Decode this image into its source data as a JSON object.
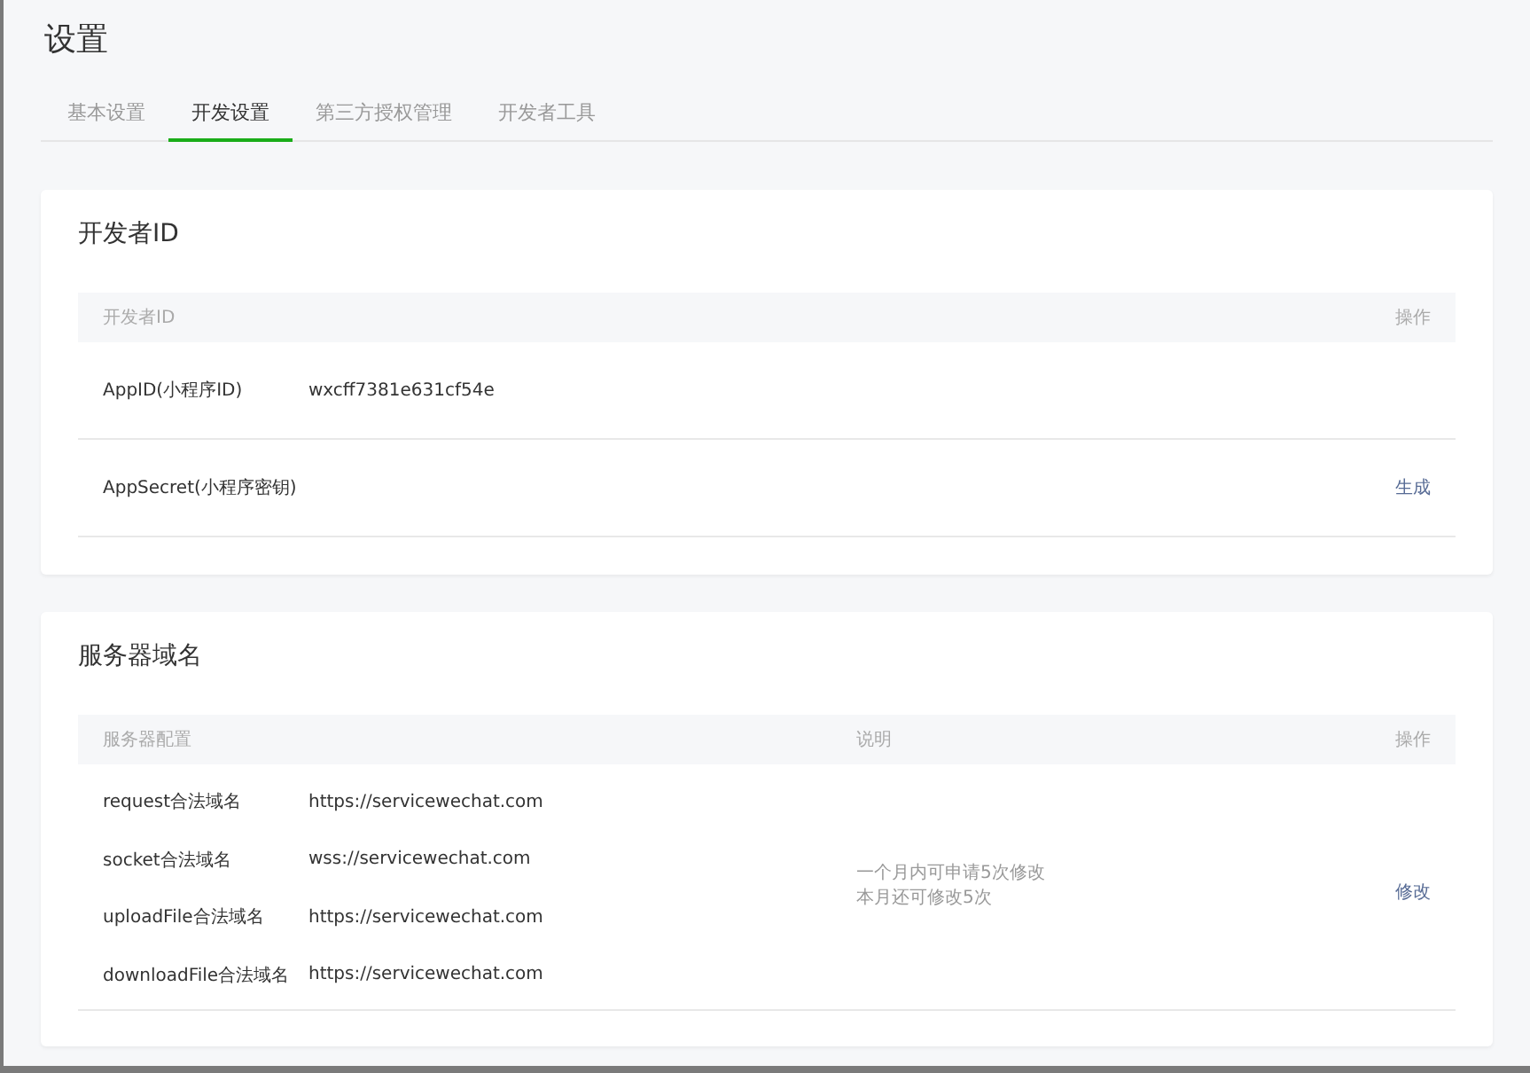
{
  "title": "设置",
  "tabs": [
    {
      "label": "基本设置",
      "selected": false
    },
    {
      "label": "开发设置",
      "selected": true
    },
    {
      "label": "第三方授权管理",
      "selected": false
    },
    {
      "label": "开发者工具",
      "selected": false
    }
  ],
  "developer_id": {
    "title": "开发者ID",
    "columns": [
      "开发者ID",
      "操作"
    ],
    "rows": [
      {
        "name": "AppID(小程序ID)",
        "value": "wxcff7381e631cf54e"
      },
      {
        "name": "AppSecret(小程序密钥)",
        "action": "生成"
      }
    ]
  },
  "server_domains": {
    "title": "服务器域名",
    "columns": [
      "服务器配置",
      "说明",
      "操作"
    ],
    "rows": [
      {
        "name": "request合法域名",
        "value": "https://servicewechat.com"
      },
      {
        "name": "socket合法域名",
        "value": "wss://servicewechat.com"
      },
      {
        "name": "uploadFile合法域名",
        "value": "https://servicewechat.com"
      },
      {
        "name": "downloadFile合法域名",
        "value": "https://servicewechat.com"
      }
    ],
    "notes": [
      "一个月内可申请5次修改",
      "本月还可修改5次"
    ],
    "action": "修改"
  }
}
